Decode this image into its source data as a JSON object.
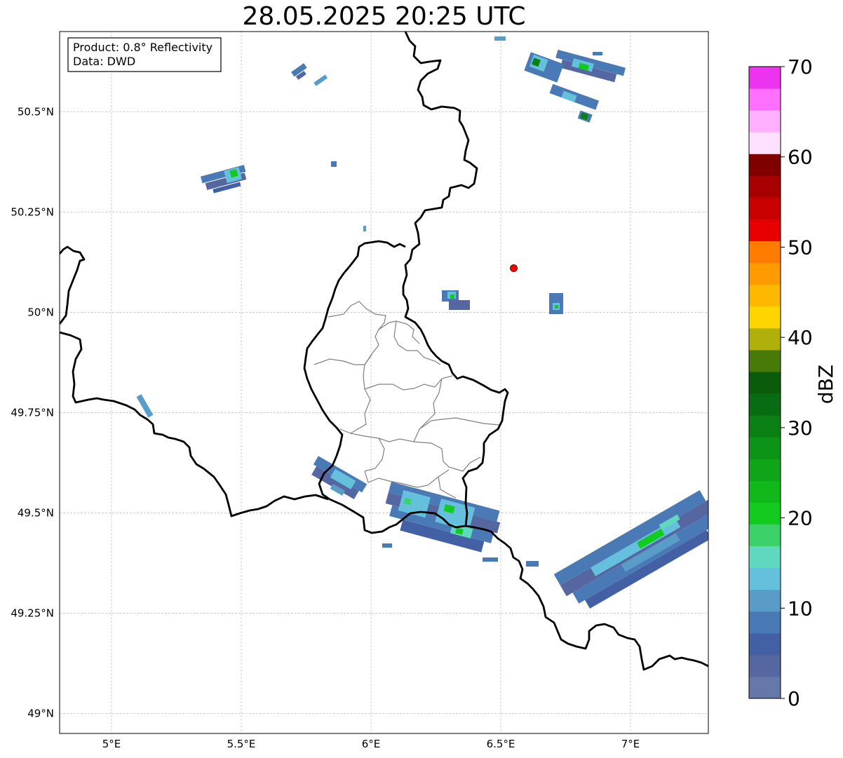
{
  "title": "28.05.2025 20:25 UTC",
  "info_box": {
    "product": "Product: 0.8° Reflectivity",
    "data_source": "Data: DWD"
  },
  "axes": {
    "lon_range": [
      4.8,
      7.3
    ],
    "lat_range": [
      48.95,
      50.7
    ],
    "lon_ticks": [
      {
        "value": 5.0,
        "label": "5°E"
      },
      {
        "value": 5.5,
        "label": "5.5°E"
      },
      {
        "value": 6.0,
        "label": "6°E"
      },
      {
        "value": 6.5,
        "label": "6.5°E"
      },
      {
        "value": 7.0,
        "label": "7°E"
      }
    ],
    "lat_ticks": [
      {
        "value": 49.0,
        "label": "49°N"
      },
      {
        "value": 49.25,
        "label": "49.25°N"
      },
      {
        "value": 49.5,
        "label": "49.5°N"
      },
      {
        "value": 49.75,
        "label": "49.75°N"
      },
      {
        "value": 50.0,
        "label": "50°N"
      },
      {
        "value": 50.25,
        "label": "50.25°N"
      },
      {
        "value": 50.5,
        "label": "50.5°N"
      }
    ],
    "grid": true
  },
  "radar_site": {
    "lon": 6.55,
    "lat": 50.11,
    "color": "#ff0000"
  },
  "colorbar": {
    "label": "dBZ",
    "range": [
      0,
      70
    ],
    "tick_labels": [
      "0",
      "10",
      "20",
      "30",
      "40",
      "50",
      "60",
      "70"
    ],
    "colors": [
      "#6677aa",
      "#5566a0",
      "#4460a5",
      "#4a7ab5",
      "#5a9cc8",
      "#64c0dc",
      "#60d8c0",
      "#3cd26a",
      "#12cb1e",
      "#10b81a",
      "#0ea618",
      "#0c9416",
      "#0a8014",
      "#086c12",
      "#0a5c0a",
      "#487a0a",
      "#b0b00a",
      "#ffd500",
      "#ffb800",
      "#ff9a00",
      "#ff7c00",
      "#e60000",
      "#c80000",
      "#a80000",
      "#800000",
      "#ffe0ff",
      "#ffb0ff",
      "#ff70ff",
      "#ee33ee"
    ]
  }
}
